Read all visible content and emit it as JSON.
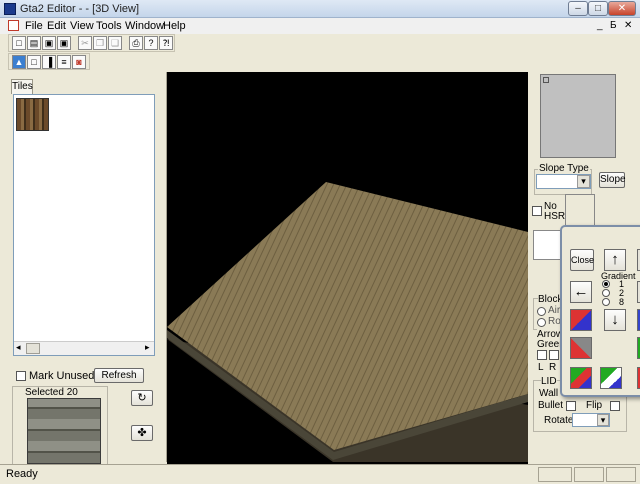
{
  "window": {
    "title": "Gta2 Editor - - [3D View]",
    "min": "–",
    "max": "□",
    "close": "✕"
  },
  "menu": [
    "File",
    "Edit",
    "View",
    "Tools",
    "Window",
    "Help"
  ],
  "mdi": {
    "min": "_",
    "restore": "Б",
    "close": "✕"
  },
  "toolbar1": [
    "new-icon",
    "open-icon",
    "save-icon",
    "save-all-icon",
    "cut-icon",
    "copy-icon",
    "paste-icon",
    "print-icon",
    "help-icon",
    "context-help-icon"
  ],
  "toolbar1_glyphs": [
    "□",
    "▤",
    "▣",
    "▣",
    "✂",
    "❐",
    "❑",
    "⎙",
    "?",
    "⁈"
  ],
  "toolbar2": [
    "view-3d-icon",
    "view-2d-icon",
    "view-flat-icon",
    "view-grid-icon",
    "view-redblock-icon"
  ],
  "toolbar2_glyphs": [
    "▲",
    "□",
    "▐",
    "≡",
    "◙"
  ],
  "left": {
    "tab": "Tiles",
    "mark_unused": "Mark Unused Tiles",
    "refresh": "Refresh",
    "selected": "Selected 20",
    "scroll_left": "◂",
    "scroll_right": "▸",
    "btn_a": "↻",
    "btn_b": "✤"
  },
  "right": {
    "slope_type": "Slope Type",
    "slope_btn": "Slope",
    "no_hsr": "No\nHSR",
    "block": "Block",
    "air": "Air",
    "ro": "Ro",
    "arrows": "Arrows",
    "green": "Green",
    "l": "L",
    "r": "R",
    "lid": "LID",
    "wall": "Wall",
    "bullet": "Bullet",
    "flip": "Flip",
    "rotate": "Rotate",
    "dropdown": "▾"
  },
  "floating": {
    "close": "Close",
    "gradient": "Gradient",
    "g1": "1",
    "g2": "2",
    "g3": "8",
    "up": "↑",
    "down": "↓",
    "left": "←"
  },
  "status": {
    "text": "Ready"
  },
  "colors": {
    "viewport": "#000000",
    "floor": "#8a7a56"
  }
}
